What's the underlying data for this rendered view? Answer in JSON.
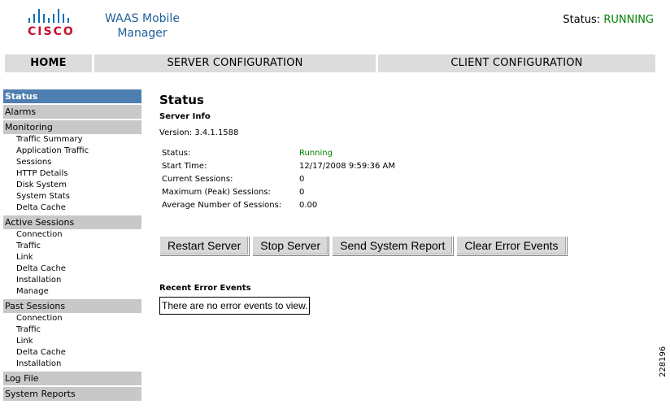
{
  "brand": {
    "logo_text": "CISCO",
    "logo_icon": "cisco-bars-icon"
  },
  "app": {
    "title_line1": "WAAS Mobile",
    "title_line2": "Manager"
  },
  "status_header": {
    "label": "Status:",
    "value": "RUNNING",
    "value_color": "#008000"
  },
  "nav": {
    "home": "HOME",
    "server_configuration": "SERVER CONFIGURATION",
    "client_configuration": "CLIENT CONFIGURATION"
  },
  "sidebar": {
    "status": "Status",
    "alarms": "Alarms",
    "monitoring": {
      "label": "Monitoring",
      "items": [
        "Traffic Summary",
        "Application Traffic",
        "Sessions",
        "HTTP Details",
        "Disk System",
        "System Stats",
        "Delta Cache"
      ]
    },
    "active_sessions": {
      "label": "Active Sessions",
      "items": [
        "Connection",
        "Traffic",
        "Link",
        "Delta Cache",
        "Installation",
        "Manage"
      ]
    },
    "past_sessions": {
      "label": "Past Sessions",
      "items": [
        "Connection",
        "Traffic",
        "Link",
        "Delta Cache",
        "Installation"
      ]
    },
    "log_file": "Log File",
    "system_reports": "System Reports"
  },
  "main": {
    "title": "Status",
    "server_info_heading": "Server Info",
    "version": "Version: 3.4.1.1588",
    "info": [
      {
        "label": "Status:",
        "value": "Running"
      },
      {
        "label": "Start Time:",
        "value": "12/17/2008 9:59:36 AM"
      },
      {
        "label": "Current Sessions:",
        "value": "0"
      },
      {
        "label": "Maximum (Peak) Sessions:",
        "value": "0"
      },
      {
        "label": "Average Number of Sessions:",
        "value": "0.00"
      }
    ],
    "buttons": {
      "restart": "Restart Server",
      "stop": "Stop Server",
      "send_report": "Send System Report",
      "clear_errors": "Clear Error Events"
    },
    "recent_errors_heading": "Recent Error Events",
    "recent_errors_text": "There are no error events to view."
  },
  "figure_id": "228196"
}
